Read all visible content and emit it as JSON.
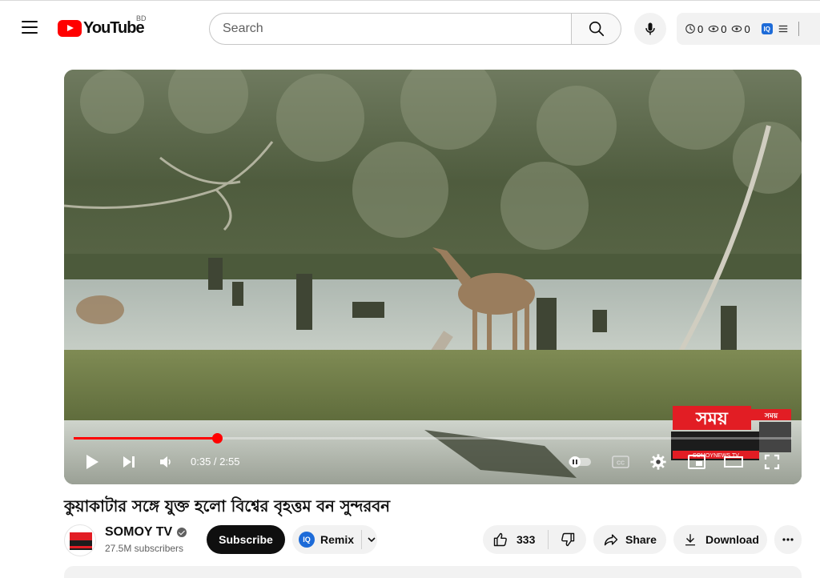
{
  "header": {
    "logo_text": "YouTube",
    "country_code": "BD",
    "search_placeholder": "Search",
    "extension": {
      "stat1": "0",
      "stat2": "0",
      "stat3": "0"
    }
  },
  "player": {
    "current_time": "0:35",
    "duration": "2:55",
    "time_display": "0:35 / 2:55",
    "progress_fraction": 0.2,
    "watermark_text": "সময়",
    "watermark_small": "সময়",
    "watermark_sub": "SOMOYNEWS.TV"
  },
  "video": {
    "title": "কুয়াকাটার সঙ্গে যুক্ত হলো বিশ্বের বৃহত্তম বন সুন্দরবন"
  },
  "channel": {
    "name": "SOMOY TV",
    "subscribers": "27.5M subscribers",
    "subscribe_label": "Subscribe",
    "remix_label": "Remix",
    "avatar_text": "সময়"
  },
  "actions": {
    "like_count": "333",
    "share_label": "Share",
    "download_label": "Download"
  },
  "colors": {
    "brand_red": "#ff0000",
    "text": "#0f0f0f",
    "muted": "#606060",
    "pill_bg": "#f2f2f2",
    "iq_blue": "#1d6bd8"
  },
  "icons": [
    "menu-icon",
    "youtube-logo-icon",
    "search-icon",
    "mic-icon",
    "clock-icon",
    "eye-icon",
    "eye-icon",
    "iq-icon",
    "list-icon",
    "play-icon",
    "next-icon",
    "volume-icon",
    "autoplay-toggle-icon",
    "cc-icon",
    "settings-icon",
    "miniplayer-icon",
    "theater-icon",
    "fullscreen-icon",
    "verified-icon",
    "chevron-down-icon",
    "like-icon",
    "dislike-icon",
    "share-icon",
    "download-icon",
    "more-icon"
  ]
}
